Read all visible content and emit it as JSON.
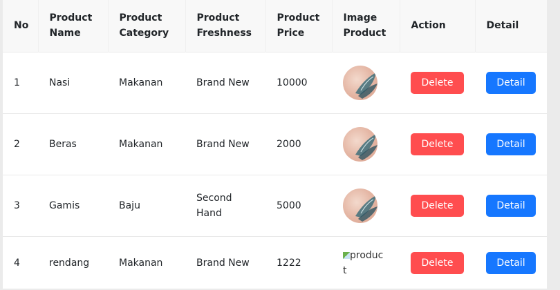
{
  "table": {
    "headers": [
      "No",
      "Product Name",
      "Product Category",
      "Product Freshness",
      "Product Price",
      "Image Product",
      "Action",
      "Detail"
    ],
    "rows": [
      {
        "no": "1",
        "name": "Nasi",
        "category": "Makanan",
        "freshness": "Brand New",
        "price": "10000",
        "image": "thumbnail",
        "action": "Delete",
        "detail": "Detail"
      },
      {
        "no": "2",
        "name": "Beras",
        "category": "Makanan",
        "freshness": "Brand New",
        "price": "2000",
        "image": "thumbnail",
        "action": "Delete",
        "detail": "Detail"
      },
      {
        "no": "3",
        "name": "Gamis",
        "category": "Baju",
        "freshness": "Second Hand",
        "price": "5000",
        "image": "thumbnail",
        "action": "Delete",
        "detail": "Detail"
      },
      {
        "no": "4",
        "name": "rendang",
        "category": "Makanan",
        "freshness": "Brand New",
        "price": "1222",
        "image_alt": "product",
        "action": "Delete",
        "detail": "Detail"
      }
    ]
  },
  "colors": {
    "delete_button": "#ff4d4f",
    "detail_button": "#1677ff",
    "header_bg": "#f8f8f8"
  },
  "icons": {
    "product_thumbnail": "leaf-photo-thumbnail",
    "broken_image": "broken-image-icon"
  }
}
